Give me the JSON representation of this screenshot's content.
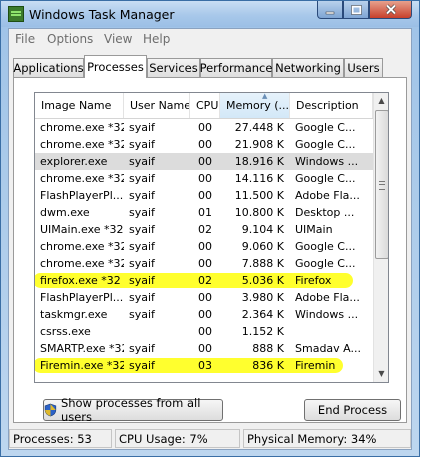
{
  "window": {
    "title": "Windows Task Manager"
  },
  "menu": [
    "File",
    "Options",
    "View",
    "Help"
  ],
  "tabs": [
    "Applications",
    "Processes",
    "Services",
    "Performance",
    "Networking",
    "Users"
  ],
  "active_tab": "Processes",
  "columns": [
    "Image Name",
    "User Name",
    "CPU",
    "Memory (...",
    "Description"
  ],
  "rows": [
    [
      "chrome.exe *32",
      "syaif",
      "00",
      "27.448 K",
      "Google C..."
    ],
    [
      "chrome.exe *32",
      "syaif",
      "00",
      "21.908 K",
      "Google C..."
    ],
    [
      "explorer.exe",
      "syaif",
      "00",
      "18.916 K",
      "Windows ..."
    ],
    [
      "chrome.exe *32",
      "syaif",
      "00",
      "14.116 K",
      "Google C..."
    ],
    [
      "FlashPlayerPl...",
      "syaif",
      "00",
      "11.500 K",
      "Adobe Fla..."
    ],
    [
      "dwm.exe",
      "syaif",
      "01",
      "10.800 K",
      "Desktop ..."
    ],
    [
      "UIMain.exe *32",
      "syaif",
      "02",
      "9.104 K",
      "UIMain"
    ],
    [
      "chrome.exe *32",
      "syaif",
      "00",
      "9.060 K",
      "Google C..."
    ],
    [
      "chrome.exe *32",
      "syaif",
      "00",
      "7.888 K",
      "Google C..."
    ],
    [
      "firefox.exe *32",
      "syaif",
      "02",
      "5.036 K",
      "Firefox"
    ],
    [
      "FlashPlayerPl...",
      "syaif",
      "00",
      "3.980 K",
      "Adobe Fla..."
    ],
    [
      "taskmgr.exe",
      "syaif",
      "00",
      "2.364 K",
      "Windows ..."
    ],
    [
      "csrss.exe",
      "",
      "00",
      "1.152 K",
      ""
    ],
    [
      "SMARTP.exe *32",
      "syaif",
      "00",
      "888 K",
      "Smadav A..."
    ],
    [
      "Firemin.exe *32",
      "syaif",
      "03",
      "836 K",
      "Firemin"
    ]
  ],
  "selected_row": 2,
  "highlighted_rows": [
    9,
    14
  ],
  "buttons": {
    "show_all": "Show processes from all users",
    "end_process": "End Process"
  },
  "status": {
    "processes": "Processes: 53",
    "cpu": "CPU Usage: 7%",
    "memory": "Physical Memory: 34%"
  },
  "colors": {
    "highlight": "#ffff00",
    "selection": "#dcdcdc",
    "frame": "#a8c8ea"
  },
  "icons": {
    "app": "task-manager-icon",
    "shield": "uac-shield-icon"
  }
}
